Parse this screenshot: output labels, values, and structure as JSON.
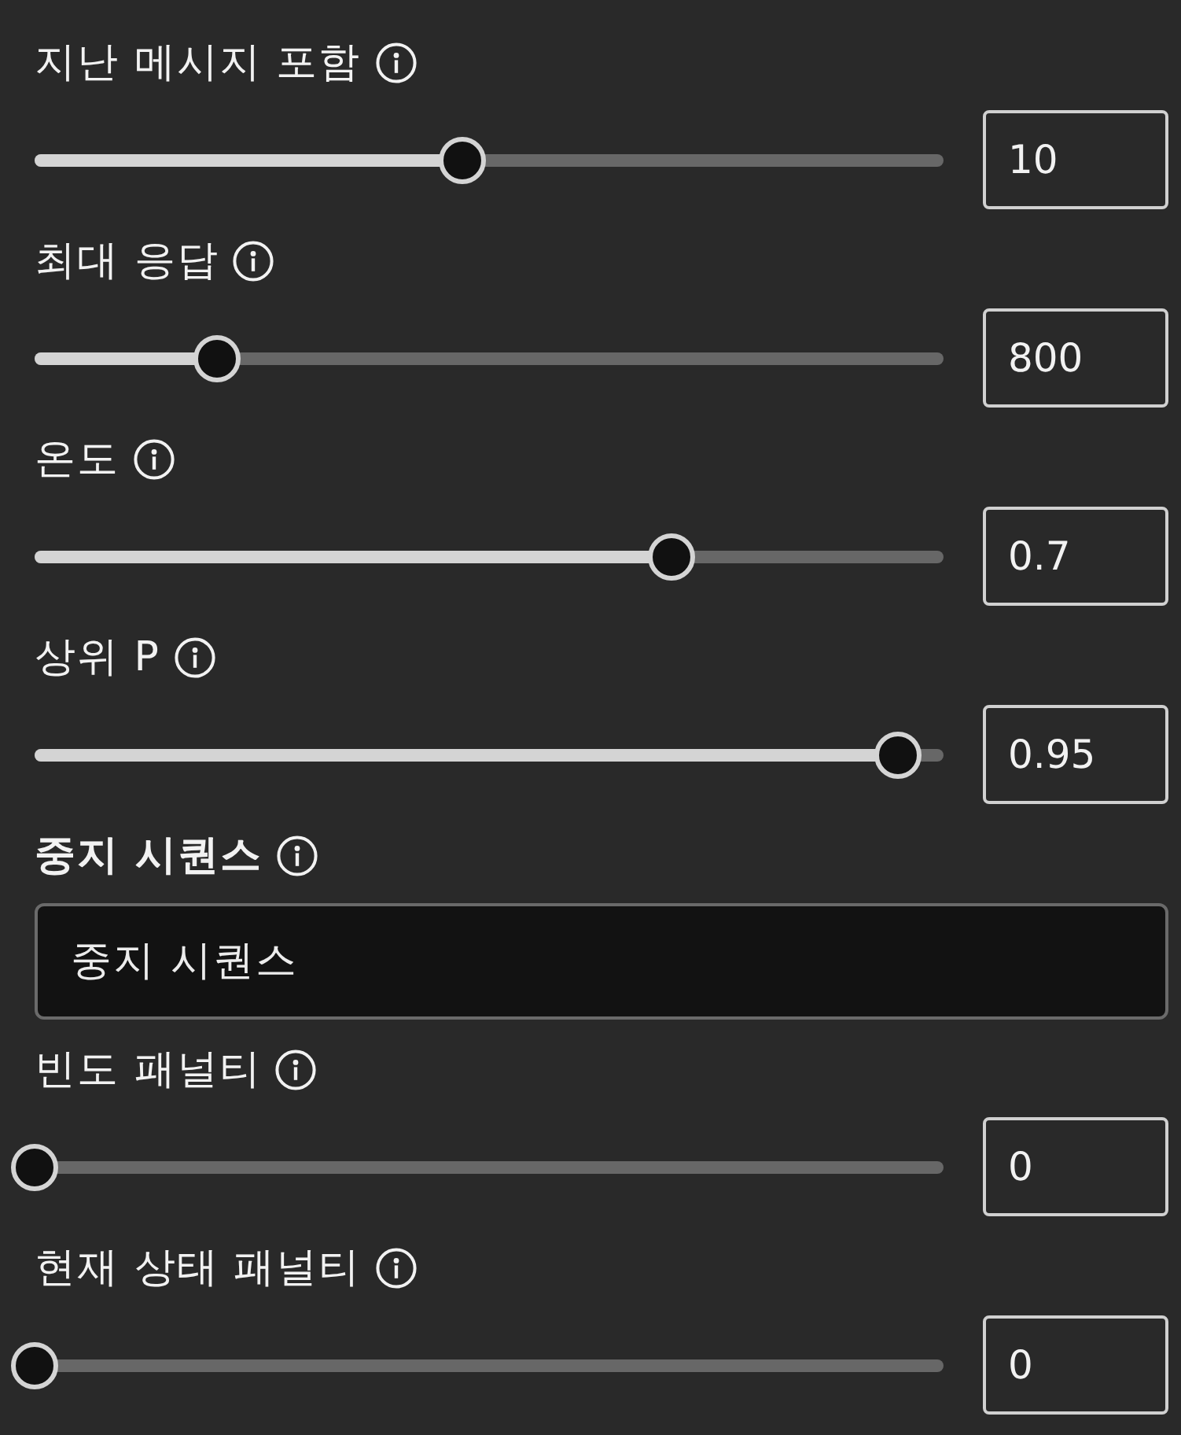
{
  "settings": [
    {
      "kind": "slider",
      "label": "지난 메시지 포함",
      "level": 0.47,
      "value": "10"
    },
    {
      "kind": "slider",
      "label": "최대 응답",
      "level": 0.2,
      "value": "800"
    },
    {
      "kind": "slider",
      "label": "온도",
      "level": 0.7,
      "value": "0.7"
    },
    {
      "kind": "slider",
      "label": "상위 P",
      "level": 0.95,
      "value": "0.95"
    },
    {
      "kind": "text",
      "label": "중지 시퀀스",
      "placeholder": "중지 시퀀스"
    },
    {
      "kind": "slider",
      "label": "빈도 패널티",
      "level": 0,
      "value": "0"
    },
    {
      "kind": "slider",
      "label": "현재 상태 패널티",
      "level": 0,
      "value": "0"
    }
  ]
}
